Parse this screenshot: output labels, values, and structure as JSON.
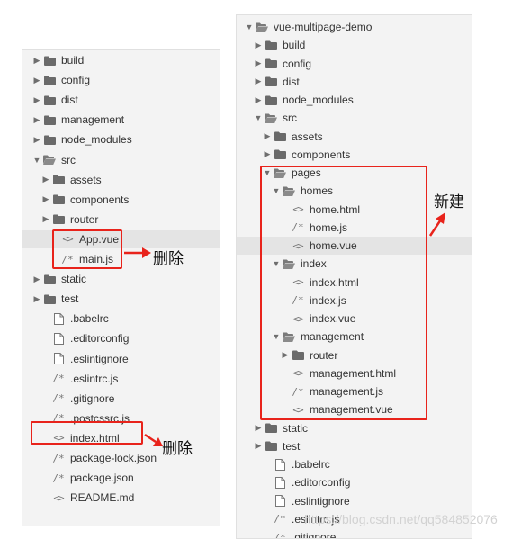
{
  "left_tree": [
    {
      "label": "build",
      "type": "folder",
      "depth": 0,
      "expanded": false
    },
    {
      "label": "config",
      "type": "folder",
      "depth": 0,
      "expanded": false
    },
    {
      "label": "dist",
      "type": "folder",
      "depth": 0,
      "expanded": false
    },
    {
      "label": "management",
      "type": "folder",
      "depth": 0,
      "expanded": false
    },
    {
      "label": "node_modules",
      "type": "folder",
      "depth": 0,
      "expanded": false
    },
    {
      "label": "src",
      "type": "folder",
      "depth": 0,
      "expanded": true
    },
    {
      "label": "assets",
      "type": "folder",
      "depth": 1,
      "expanded": false
    },
    {
      "label": "components",
      "type": "folder",
      "depth": 1,
      "expanded": false
    },
    {
      "label": "router",
      "type": "folder",
      "depth": 1,
      "expanded": false
    },
    {
      "label": "App.vue",
      "type": "code",
      "depth": 2,
      "selected": true
    },
    {
      "label": "main.js",
      "type": "comment",
      "depth": 2
    },
    {
      "label": "static",
      "type": "folder",
      "depth": 0,
      "expanded": false
    },
    {
      "label": "test",
      "type": "folder",
      "depth": 0,
      "expanded": false
    },
    {
      "label": ".babelrc",
      "type": "file",
      "depth": 1
    },
    {
      "label": ".editorconfig",
      "type": "file",
      "depth": 1
    },
    {
      "label": ".eslintignore",
      "type": "file",
      "depth": 1
    },
    {
      "label": ".eslintrc.js",
      "type": "comment",
      "depth": 1
    },
    {
      "label": ".gitignore",
      "type": "comment",
      "depth": 1
    },
    {
      "label": ".postcssrc.js",
      "type": "comment",
      "depth": 1
    },
    {
      "label": "index.html",
      "type": "code",
      "depth": 1
    },
    {
      "label": "package-lock.json",
      "type": "comment",
      "depth": 1
    },
    {
      "label": "package.json",
      "type": "comment",
      "depth": 1
    },
    {
      "label": "README.md",
      "type": "code",
      "depth": 1
    }
  ],
  "right_tree": [
    {
      "label": "vue-multipage-demo",
      "type": "folder",
      "depth": 0,
      "expanded": true
    },
    {
      "label": "build",
      "type": "folder",
      "depth": 1,
      "expanded": false
    },
    {
      "label": "config",
      "type": "folder",
      "depth": 1,
      "expanded": false
    },
    {
      "label": "dist",
      "type": "folder",
      "depth": 1,
      "expanded": false
    },
    {
      "label": "node_modules",
      "type": "folder",
      "depth": 1,
      "expanded": false
    },
    {
      "label": "src",
      "type": "folder",
      "depth": 1,
      "expanded": true
    },
    {
      "label": "assets",
      "type": "folder",
      "depth": 2,
      "expanded": false
    },
    {
      "label": "components",
      "type": "folder",
      "depth": 2,
      "expanded": false
    },
    {
      "label": "pages",
      "type": "folder",
      "depth": 2,
      "expanded": true
    },
    {
      "label": "homes",
      "type": "folder",
      "depth": 3,
      "expanded": true
    },
    {
      "label": "home.html",
      "type": "code",
      "depth": 4
    },
    {
      "label": "home.js",
      "type": "comment",
      "depth": 4
    },
    {
      "label": "home.vue",
      "type": "code",
      "depth": 4,
      "selected": true
    },
    {
      "label": "index",
      "type": "folder",
      "depth": 3,
      "expanded": true
    },
    {
      "label": "index.html",
      "type": "code",
      "depth": 4
    },
    {
      "label": "index.js",
      "type": "comment",
      "depth": 4
    },
    {
      "label": "index.vue",
      "type": "code",
      "depth": 4
    },
    {
      "label": "management",
      "type": "folder",
      "depth": 3,
      "expanded": true
    },
    {
      "label": "router",
      "type": "folder",
      "depth": 4,
      "expanded": false
    },
    {
      "label": "management.html",
      "type": "code",
      "depth": 4
    },
    {
      "label": "management.js",
      "type": "comment",
      "depth": 4
    },
    {
      "label": "management.vue",
      "type": "code",
      "depth": 4
    },
    {
      "label": "static",
      "type": "folder",
      "depth": 1,
      "expanded": false
    },
    {
      "label": "test",
      "type": "folder",
      "depth": 1,
      "expanded": false
    },
    {
      "label": ".babelrc",
      "type": "file",
      "depth": 2
    },
    {
      "label": ".editorconfig",
      "type": "file",
      "depth": 2
    },
    {
      "label": ".eslintignore",
      "type": "file",
      "depth": 2
    },
    {
      "label": ".eslintrc.js",
      "type": "comment",
      "depth": 2
    },
    {
      "label": ".gitignore",
      "type": "comment",
      "depth": 2
    }
  ],
  "annotations": {
    "delete_main": "删除",
    "delete_index": "删除",
    "new_pages": "新建"
  },
  "watermark": "https://blog.csdn.net/qq584852076",
  "colors": {
    "annotation_red": "#e8231b",
    "folder": "#6a6a6a",
    "panel_bg": "#f3f3f3",
    "selected_row": "#e4e4e4"
  }
}
